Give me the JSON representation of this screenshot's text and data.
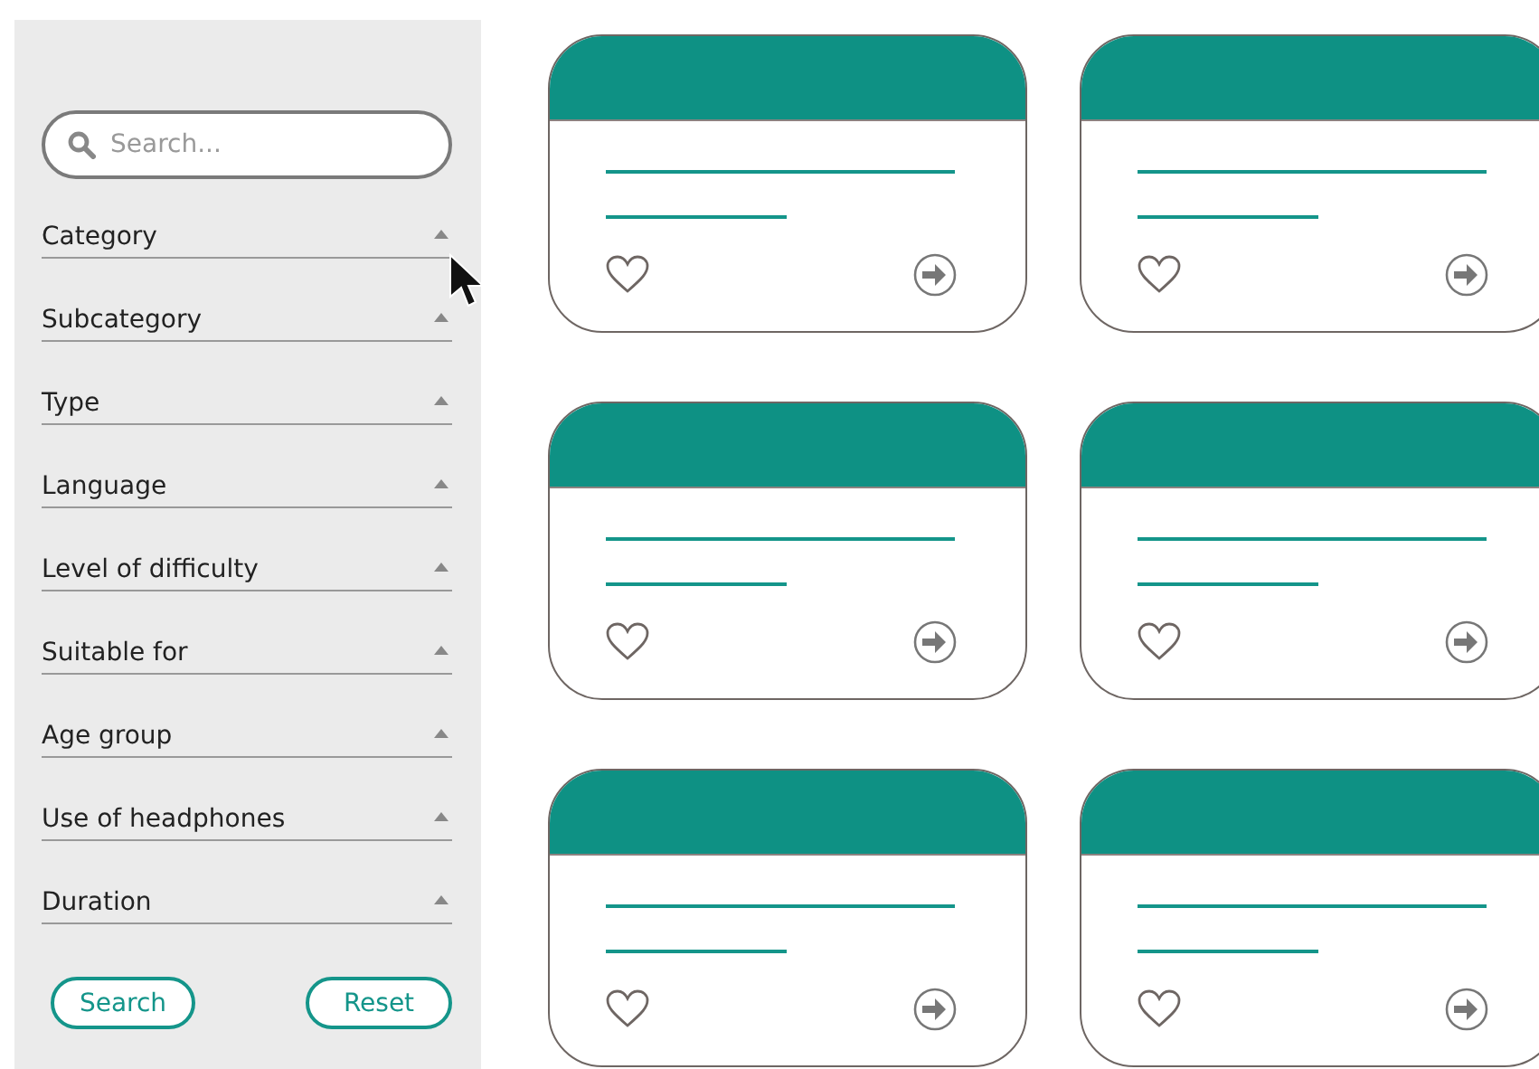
{
  "sidebar": {
    "search": {
      "placeholder": "Search..."
    },
    "filters": [
      {
        "label": "Category"
      },
      {
        "label": "Subcategory"
      },
      {
        "label": "Type"
      },
      {
        "label": "Language"
      },
      {
        "label": "Level of difficulty"
      },
      {
        "label": "Suitable for"
      },
      {
        "label": "Age group"
      },
      {
        "label": "Use of headphones"
      },
      {
        "label": "Duration"
      }
    ],
    "buttons": [
      "Search",
      "Reset"
    ]
  },
  "cards": [
    {
      "liked": false
    },
    {
      "liked": false
    },
    {
      "liked": false
    },
    {
      "liked": false
    },
    {
      "liked": false
    },
    {
      "liked": false
    }
  ]
}
